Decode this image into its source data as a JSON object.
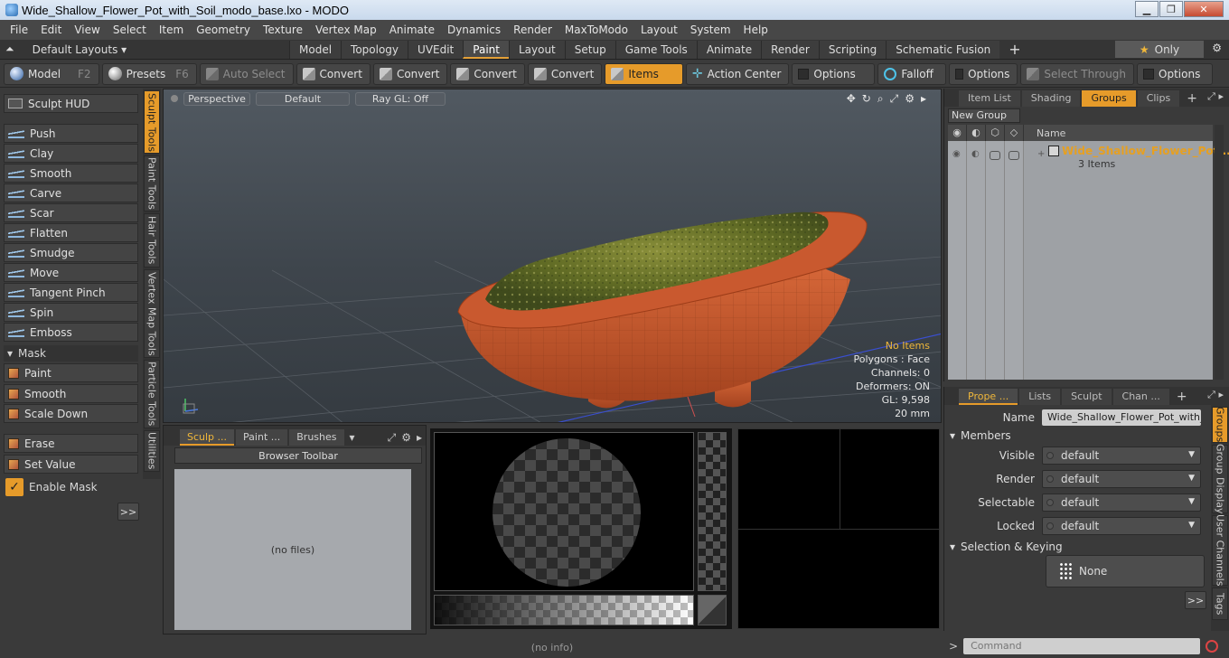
{
  "window": {
    "title": "Wide_Shallow_Flower_Pot_with_Soil_modo_base.lxo - MODO"
  },
  "menu": [
    "File",
    "Edit",
    "View",
    "Select",
    "Item",
    "Geometry",
    "Texture",
    "Vertex Map",
    "Animate",
    "Dynamics",
    "Render",
    "MaxToModo",
    "Layout",
    "System",
    "Help"
  ],
  "layouts": {
    "label": "Default Layouts",
    "tabs": [
      {
        "label": "Model"
      },
      {
        "label": "Topology"
      },
      {
        "label": "UVEdit"
      },
      {
        "label": "Paint"
      },
      {
        "label": "Layout"
      },
      {
        "label": "Setup"
      },
      {
        "label": "Game Tools"
      },
      {
        "label": "Animate"
      },
      {
        "label": "Render"
      },
      {
        "label": "Scripting"
      },
      {
        "label": "Schematic Fusion"
      }
    ],
    "active_tab": "Paint",
    "only_label": "Only"
  },
  "toolbar": {
    "model": "Model",
    "model_key": "F2",
    "presets": "Presets",
    "presets_key": "F6",
    "auto_select": "Auto Select",
    "convert": "Convert",
    "items": "Items",
    "action_center": "Action Center",
    "options": "Options",
    "falloff": "Falloff",
    "select_through": "Select Through"
  },
  "sculpt": {
    "hud": "Sculpt HUD",
    "tools": [
      "Push",
      "Clay",
      "Smooth",
      "Carve",
      "Scar",
      "Flatten",
      "Smudge",
      "Move",
      "Tangent Pinch",
      "Spin",
      "Emboss"
    ],
    "mask_header": "Mask",
    "mask_tools": [
      "Paint",
      "Smooth",
      "Scale Down"
    ],
    "erase": "Erase",
    "set_value": "Set Value",
    "enable_mask": "Enable Mask",
    "more": ">>"
  },
  "vertical_tabs": [
    "Sculpt Tools",
    "Paint Tools",
    "Hair Tools",
    "Vertex Map Tools",
    "Particle Tools",
    "Utilities"
  ],
  "viewport": {
    "view": "Perspective",
    "style": "Default",
    "raygl": "Ray GL: Off",
    "info": {
      "items": "No Items",
      "polygons": "Polygons : Face",
      "channels": "Channels: 0",
      "deformers": "Deformers: ON",
      "gl": "GL: 9,598",
      "scale": "20 mm"
    }
  },
  "browser": {
    "tabs": [
      "Sculp ...",
      "Paint ...",
      "Brushes"
    ],
    "toolbar": "Browser Toolbar",
    "empty": "(no files)"
  },
  "status": {
    "info": "(no info)"
  },
  "groups_panel": {
    "tabs": [
      "Item List",
      "Shading",
      "Groups",
      "Clips"
    ],
    "new_group": "New Group",
    "col_name": "Name",
    "group_name": "Wide_Shallow_Flower_Pot ...",
    "group_count": "3 Items"
  },
  "properties": {
    "tabs": [
      "Prope ...",
      "Lists",
      "Sculpt",
      "Chan ..."
    ],
    "name_label": "Name",
    "name_value": "Wide_Shallow_Flower_Pot_with_S",
    "members_header": "Members",
    "visible_label": "Visible",
    "visible_value": "default",
    "render_label": "Render",
    "render_value": "default",
    "selectable_label": "Selectable",
    "selectable_value": "default",
    "locked_label": "Locked",
    "locked_value": "default",
    "selkey_header": "Selection & Keying",
    "none_label": "None",
    "more": ">>",
    "side_tabs": [
      "Groups",
      "Group Display",
      "User Channels",
      "Tags"
    ]
  },
  "command": {
    "placeholder": "Command",
    "prompt": ">"
  },
  "colors": {
    "accent": "#e69b2a",
    "pot": "#c8582e",
    "moss": "#6f7a2a"
  }
}
